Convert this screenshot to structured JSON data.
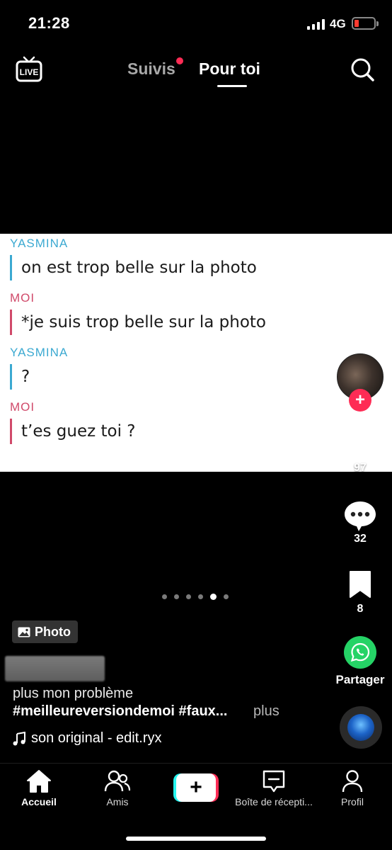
{
  "status_bar": {
    "time": "21:28",
    "network": "4G"
  },
  "top_nav": {
    "live_label": "LIVE",
    "tabs": [
      {
        "label": "Suivis",
        "notification_dot": true
      },
      {
        "label": "Pour toi",
        "active": true
      }
    ]
  },
  "post": {
    "messages": [
      {
        "sender": "YASMINA",
        "text": "on est trop belle sur la photo"
      },
      {
        "sender": "MOI",
        "text": "*je suis trop belle sur la photo"
      },
      {
        "sender": "YASMINA",
        "text": "?"
      },
      {
        "sender": "MOI",
        "text": "t’es guez toi ?"
      }
    ],
    "carousel": {
      "total": 6,
      "active_index": 4
    },
    "badge": "Photo",
    "caption_line1": "plus mon problème",
    "caption_line2": "#meilleureversiondemoi #faux...",
    "more_label": "plus",
    "sound": "son original - edit.ryx"
  },
  "actions": {
    "likes": "97",
    "comments": "32",
    "saves": "8",
    "share_label": "Partager"
  },
  "bottom_nav": {
    "items": [
      {
        "label": "Accueil",
        "icon": "home-icon",
        "active": true
      },
      {
        "label": "Amis",
        "icon": "friends-icon"
      },
      {
        "label": "Boîte de récepti...",
        "icon": "inbox-icon"
      },
      {
        "label": "Profil",
        "icon": "profile-icon"
      }
    ]
  },
  "colors": {
    "accent_red": "#fe2c55",
    "accent_cyan": "#25f4ee",
    "yasmina": "#3ba9d1",
    "moi": "#d04a6a",
    "whatsapp": "#25d366"
  }
}
